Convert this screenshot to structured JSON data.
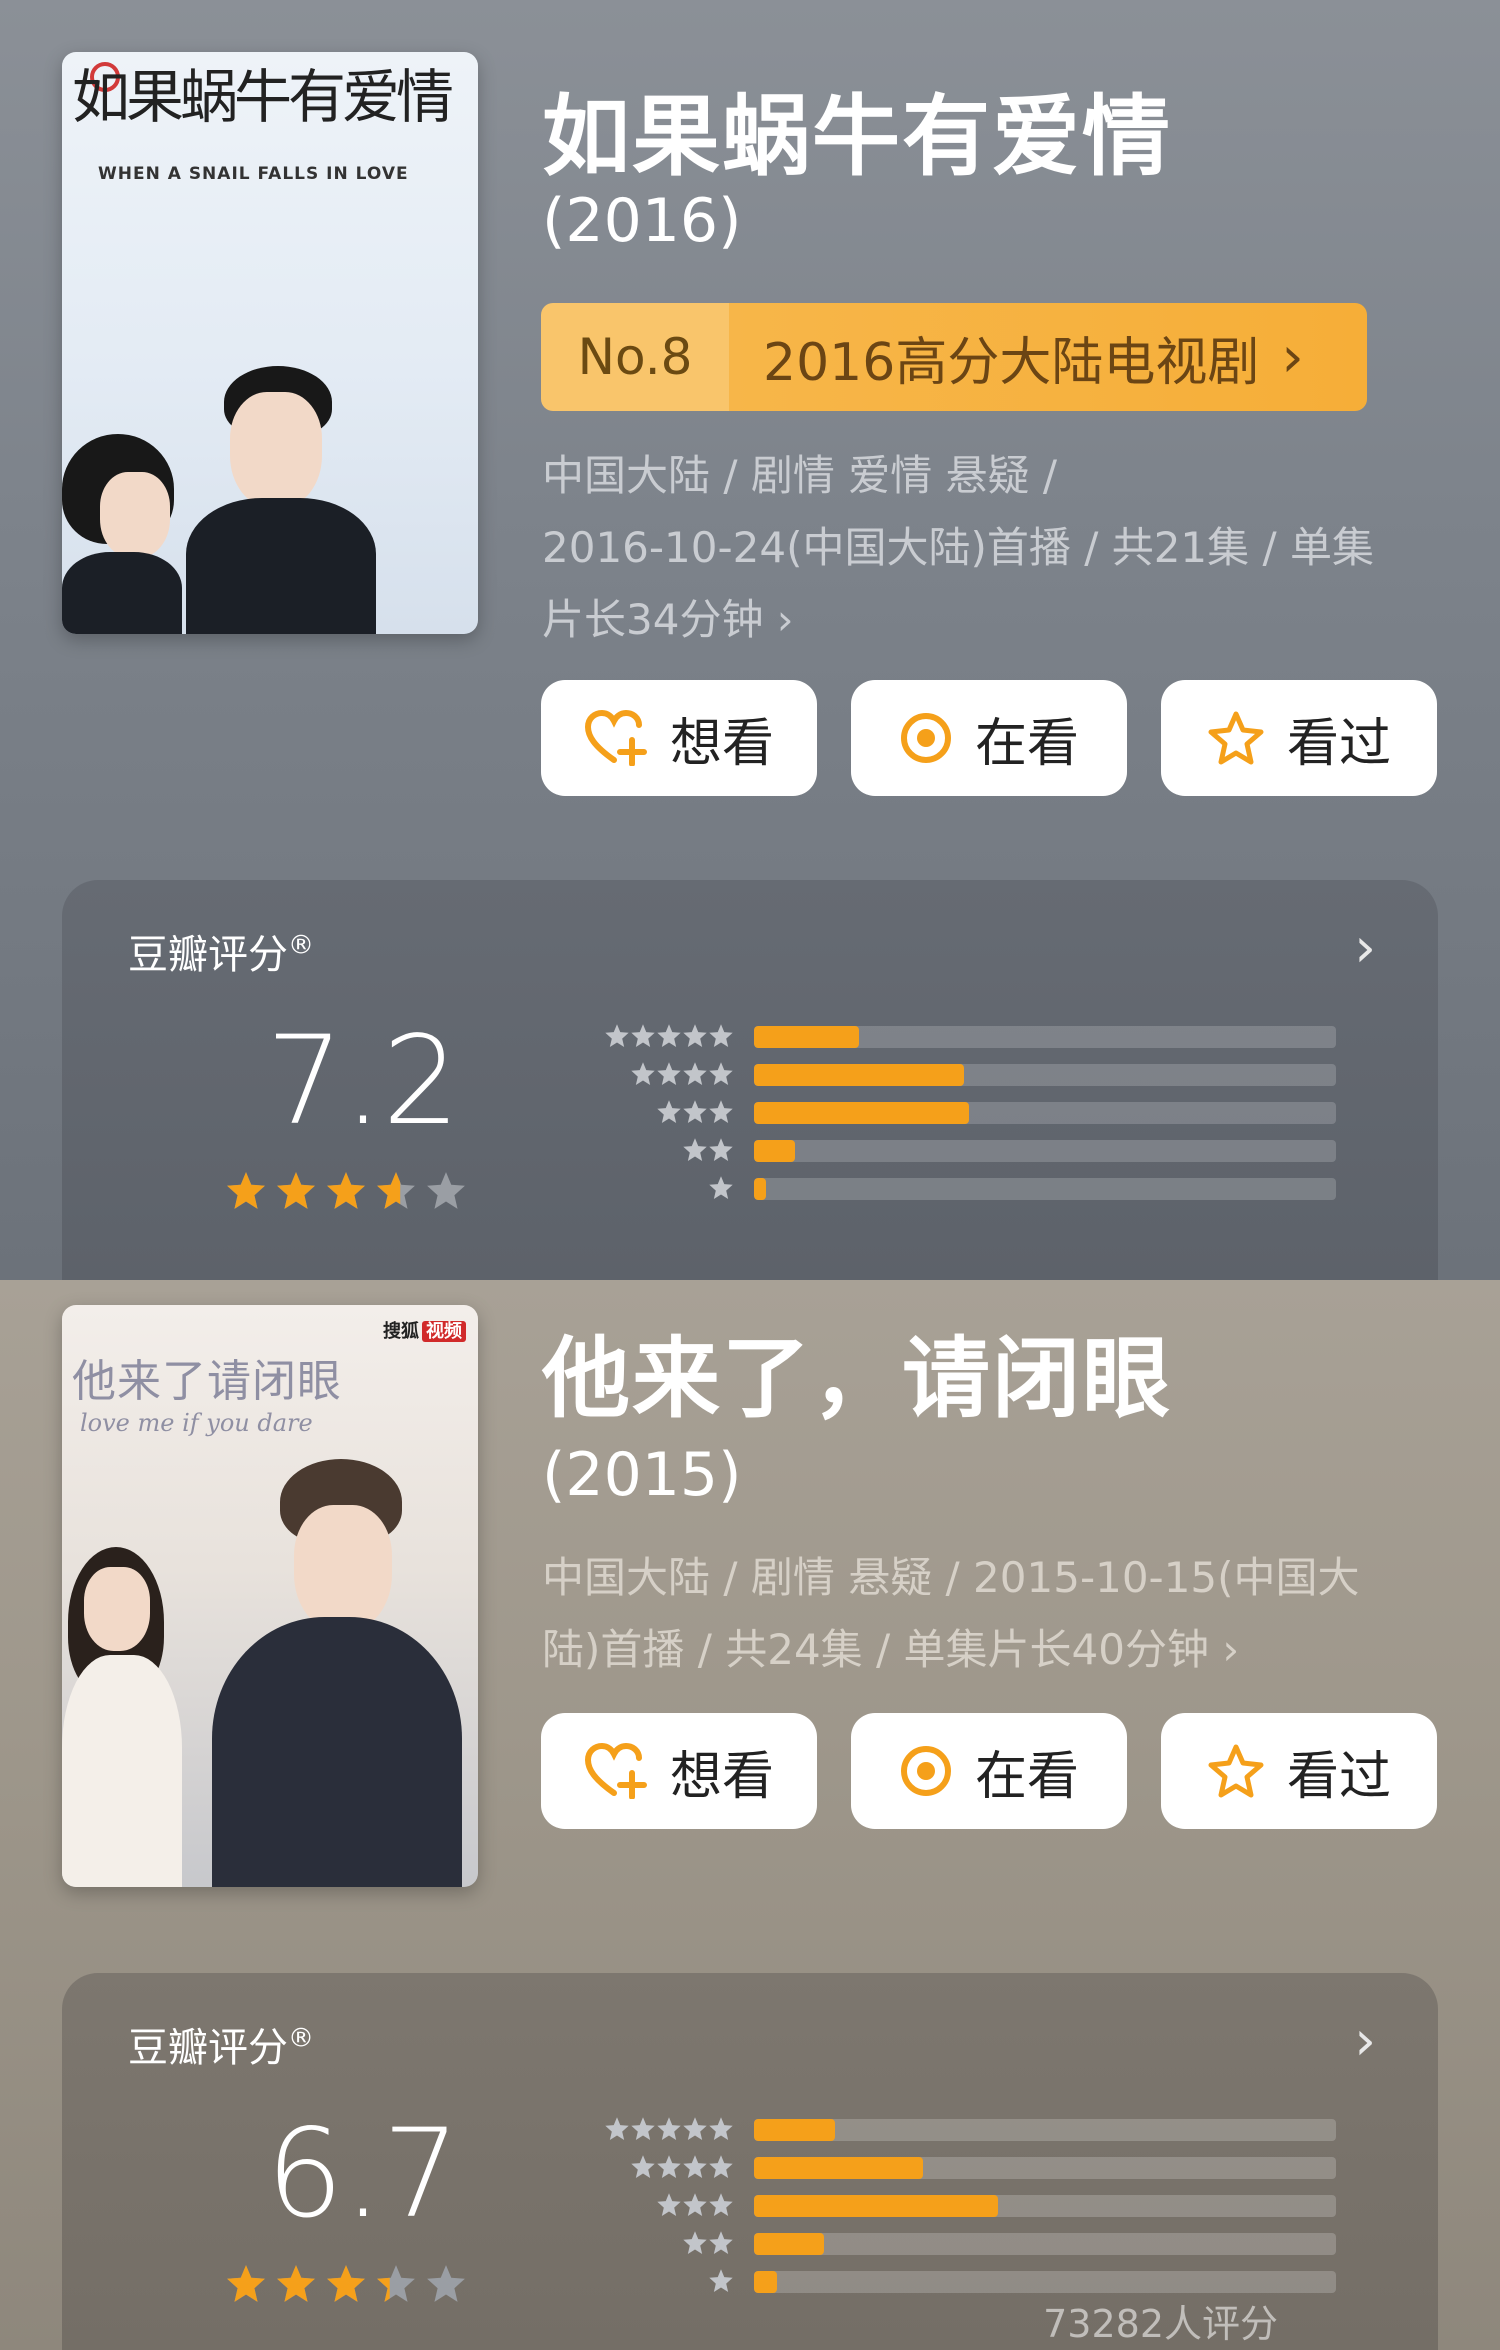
{
  "show1": {
    "poster_title": "如果蜗牛有爱情",
    "poster_subtitle": "WHEN A SNAIL FALLS IN LOVE",
    "title": "如果蜗牛有爱情",
    "year": "(2016)",
    "rank": {
      "no": "No.8",
      "name": "2016高分大陆电视剧"
    },
    "meta_line1": "中国大陆 / 剧情 爱情 悬疑 /",
    "meta_line2": "2016-10-24(中国大陆)首播 / 共21集 / 单集",
    "meta_line3": "片长34分钟 ›",
    "actions": [
      "想看",
      "在看",
      "看过"
    ],
    "rating_label": "豆瓣评分",
    "rating_mark": "®",
    "score": "7.2",
    "star_fill": 0.72,
    "distribution": [
      0.18,
      0.36,
      0.37,
      0.07,
      0.02
    ]
  },
  "show2": {
    "poster_title": "他来了请闭眼",
    "poster_subtitle": "love me if you dare",
    "poster_badge": "搜狐",
    "poster_badge2": "视频",
    "title": "他来了，请闭眼",
    "year": "(2015)",
    "meta_line1": "中国大陆 / 剧情 悬疑 / 2015-10-15(中国大",
    "meta_line2": "陆)首播 / 共24集 / 单集片长40分钟 ›",
    "actions": [
      "想看",
      "在看",
      "看过"
    ],
    "rating_label": "豆瓣评分",
    "rating_mark": "®",
    "score": "6.7",
    "star_fill": 0.67,
    "distribution": [
      0.14,
      0.29,
      0.42,
      0.12,
      0.04
    ],
    "rating_count": "73282人评分"
  },
  "colors": {
    "accent": "#f5a01a",
    "rank_bg": "#f7b649"
  }
}
